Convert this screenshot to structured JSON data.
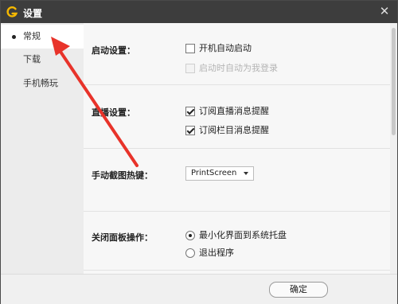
{
  "window": {
    "title": "设置",
    "close_glyph": "✕",
    "app_icon": "app-logo-icon"
  },
  "sidebar": {
    "items": [
      {
        "label": "常规",
        "active": true
      },
      {
        "label": "下载",
        "active": false
      },
      {
        "label": "手机畅玩",
        "active": false
      }
    ]
  },
  "settings": {
    "startup": {
      "label": "启动设置：",
      "options": [
        {
          "label": "开机自动启动",
          "checked": false,
          "disabled": false
        },
        {
          "label": "启动时自动为我登录",
          "checked": false,
          "disabled": true
        }
      ]
    },
    "live": {
      "label": "直播设置：",
      "options": [
        {
          "label": "订阅直播消息提醒",
          "checked": true
        },
        {
          "label": "订阅栏目消息提醒",
          "checked": true
        }
      ]
    },
    "hotkey": {
      "label": "手动截图热键：",
      "value": "PrintScreen"
    },
    "close_panel": {
      "label": "关闭面板操作：",
      "options": [
        {
          "label": "最小化界面到系统托盘",
          "selected": true
        },
        {
          "label": "退出程序",
          "selected": false
        }
      ]
    }
  },
  "footer": {
    "ok_label": "确定"
  },
  "colors": {
    "titlebar": "#3d3d3d",
    "logo": "#f5b800",
    "annotation_arrow": "#e8332a"
  }
}
